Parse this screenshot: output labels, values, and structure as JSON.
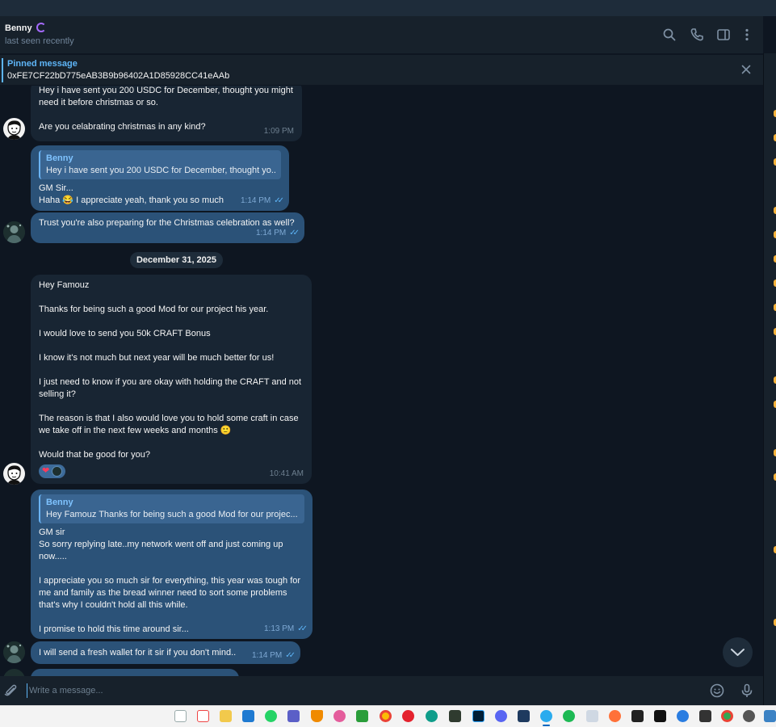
{
  "header": {
    "contact_name": "Benny",
    "status": "last seen recently"
  },
  "pinned": {
    "title": "Pinned message",
    "text": "0xFE7CF22bD775eAB3B9b96402A1D85928CC41eAAb"
  },
  "date_separator": "December 31, 2025",
  "messages": [
    {
      "lines": [
        "Hey i have sent you 200 USDC for December, thought you might",
        "need it before christmas or so.",
        "",
        "Are you celabrating christmas in any kind?"
      ],
      "time": "1:09 PM"
    },
    {
      "reply_name": "Benny",
      "reply_text": "Hey i have sent you 200 USDC for December, thought yo...",
      "lines": [
        "GM Sir...",
        "Haha 😂 I appreciate yeah, thank you so much"
      ],
      "time": "1:14 PM"
    },
    {
      "lines": [
        "Trust you're also preparing for the Christmas celebration as well?"
      ],
      "time": "1:14 PM"
    },
    {
      "lines": [
        "Hey Famouz",
        "",
        "Thanks for being such a good Mod for our project his year.",
        "",
        "I would love to send you 50k CRAFT Bonus",
        "",
        "I know it's not much but next year will be much better for us!",
        "",
        "I just need to know if you are okay with holding the CRAFT and not",
        "selling it?",
        "",
        "The reason is that I also would love you to hold some craft in case",
        "we take off in the next few weeks and months 🙂",
        "",
        "Would that be good for you?"
      ],
      "reaction": "❤",
      "time": "10:41 AM"
    },
    {
      "reply_name": "Benny",
      "reply_text": "Hey Famouz  Thanks for being such a good Mod for our projec...",
      "lines": [
        "GM sir",
        "So sorry replying late..my network went off and just coming up",
        "now.....",
        "",
        "I appreciate you so much sir for everything, this year was tough for",
        "me and family as the bread winner need to sort some problems",
        "that's why I couldn't hold all this while.",
        "",
        " I  promise to hold this time around sir..."
      ],
      "time": "1:13 PM"
    },
    {
      "lines": [
        "I will send a fresh wallet for it sir if you don't mind.."
      ],
      "time": "1:14 PM"
    }
  ],
  "composer": {
    "placeholder": "Write a message..."
  },
  "colors": {
    "background": "#0e1621",
    "incoming_bubble": "#182533",
    "outgoing_bubble": "#2b5278",
    "accent": "#5eb5f7"
  },
  "icons": {
    "header": [
      "search-icon",
      "phone-icon",
      "sidebar-toggle-icon",
      "more-icon"
    ],
    "composer": [
      "attach-icon",
      "emoji-icon",
      "microphone-icon"
    ]
  }
}
